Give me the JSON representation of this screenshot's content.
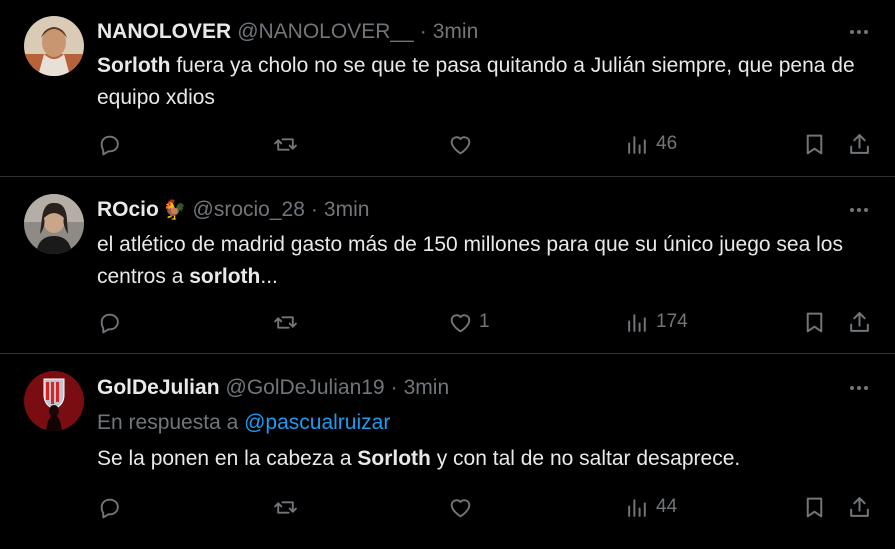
{
  "tweets": [
    {
      "author": "NANOLOVER",
      "handle": "@NANOLOVER__",
      "time": "3min",
      "body_parts": [
        {
          "text": "Sorloth",
          "bold": true
        },
        {
          "text": " fuera ya cholo no se que te pasa quitando a Julián siempre, que pena de equipo xdios",
          "bold": false
        }
      ],
      "counts": {
        "replies": "",
        "retweets": "",
        "likes": "",
        "views": "46"
      }
    },
    {
      "author": "ROcio",
      "author_emoji": "🐓",
      "handle": "@srocio_28",
      "time": "3min",
      "body_parts": [
        {
          "text": "el atlético de madrid gasto más de 150 millones para que su único juego sea los centros a ",
          "bold": false
        },
        {
          "text": "sorloth",
          "bold": true
        },
        {
          "text": "...",
          "bold": false
        }
      ],
      "counts": {
        "replies": "",
        "retweets": "",
        "likes": "1",
        "views": "174"
      }
    },
    {
      "author": "GolDeJulian",
      "handle": "@GolDeJulian19",
      "time": "3min",
      "reply_prefix": "En respuesta a",
      "reply_to": "@pascualruizar",
      "body_parts": [
        {
          "text": "Se la ponen en la cabeza a ",
          "bold": false
        },
        {
          "text": "Sorloth",
          "bold": true
        },
        {
          "text": " y con tal de no saltar desaprece.",
          "bold": false
        }
      ],
      "counts": {
        "replies": "",
        "retweets": "",
        "likes": "",
        "views": "44"
      }
    }
  ],
  "separator": "·",
  "icons": {
    "reply": "reply-icon",
    "retweet": "retweet-icon",
    "like": "heart-icon",
    "views": "views-chart-icon",
    "bookmark": "bookmark-icon",
    "share": "share-icon",
    "more": "more-dots-icon"
  },
  "colors": {
    "background": "#000000",
    "text": "#e7e9ea",
    "muted": "#71767b",
    "link": "#1d9bf0",
    "divider": "#2f3336"
  }
}
